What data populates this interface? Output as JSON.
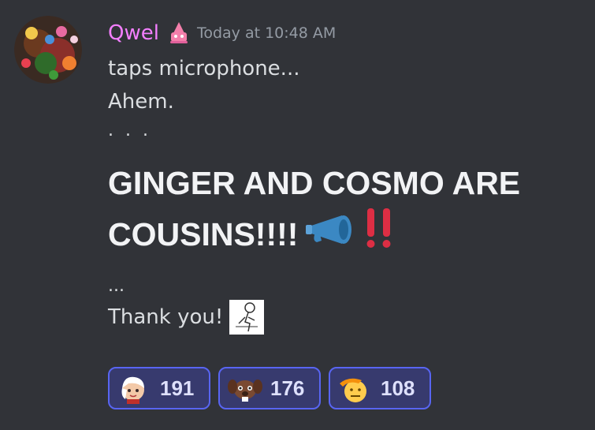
{
  "message": {
    "author": "Qwel",
    "timestamp": "Today at 10:48 AM",
    "lines": [
      "taps microphone...",
      "Ahem.",
      ". . ."
    ],
    "headline_line1": "GINGER AND COSMO ARE",
    "headline_line2": "COUSINS!!!!",
    "ellipsis": "...",
    "thanks": "Thank you!"
  },
  "icons": {
    "role": "cake-role-icon",
    "megaphone": "megaphone-emoji",
    "double_exclamation": "double-exclamation-emoji",
    "sticker": "sticker-icon"
  },
  "reactions": [
    {
      "emoji": "girl-character-emoji",
      "count": "191"
    },
    {
      "emoji": "dog-character-emoji",
      "count": "176"
    },
    {
      "emoji": "saluting-face-emoji",
      "count": "108"
    }
  ],
  "colors": {
    "background": "#313338",
    "username": "#f47fff",
    "reaction_border": "#5865f2",
    "reaction_bg": "#373a6e",
    "megaphone": "#3b88c3",
    "exclamation": "#dd2e44"
  }
}
